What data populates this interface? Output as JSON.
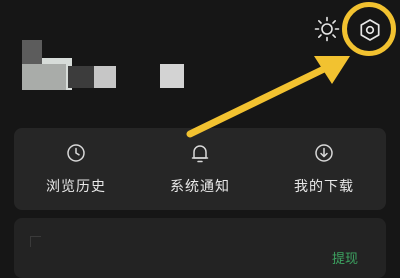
{
  "header": {
    "brightness_icon": "sun-icon",
    "settings_icon": "hexagon-settings-icon"
  },
  "annotation": {
    "highlight_color": "#f2c230"
  },
  "quick_actions": [
    {
      "label": "浏览历史",
      "icon": "clock-icon"
    },
    {
      "label": "系统通知",
      "icon": "bell-icon"
    },
    {
      "label": "我的下载",
      "icon": "download-icon"
    }
  ],
  "wallet": {
    "withdraw_label": "提现",
    "withdraw_color": "#3da562"
  }
}
